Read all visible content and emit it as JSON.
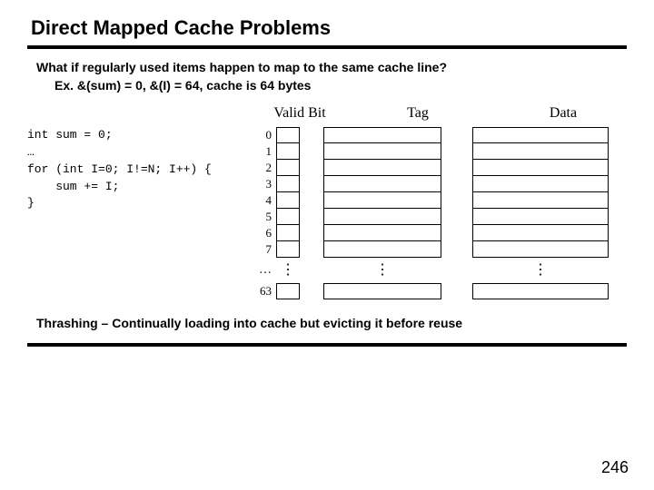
{
  "title": "Direct Mapped Cache Problems",
  "subhead": "What if regularly used items happen to map to the same cache line?",
  "subhead_ex": "Ex. &(sum) = 0, &(I) = 64, cache is 64 bytes",
  "headers": {
    "valid": "Valid Bit",
    "tag": "Tag",
    "data": "Data"
  },
  "code_lines": [
    "int sum = 0;",
    "…",
    "for (int I=0; I!=N; I++) {",
    "    sum += I;",
    "}"
  ],
  "rows": [
    "0",
    "1",
    "2",
    "3",
    "4",
    "5",
    "6",
    "7"
  ],
  "ell": "…",
  "last_row": "63",
  "bottom": "Thrashing – Continually loading into cache but evicting it before reuse",
  "pagenum": "246"
}
